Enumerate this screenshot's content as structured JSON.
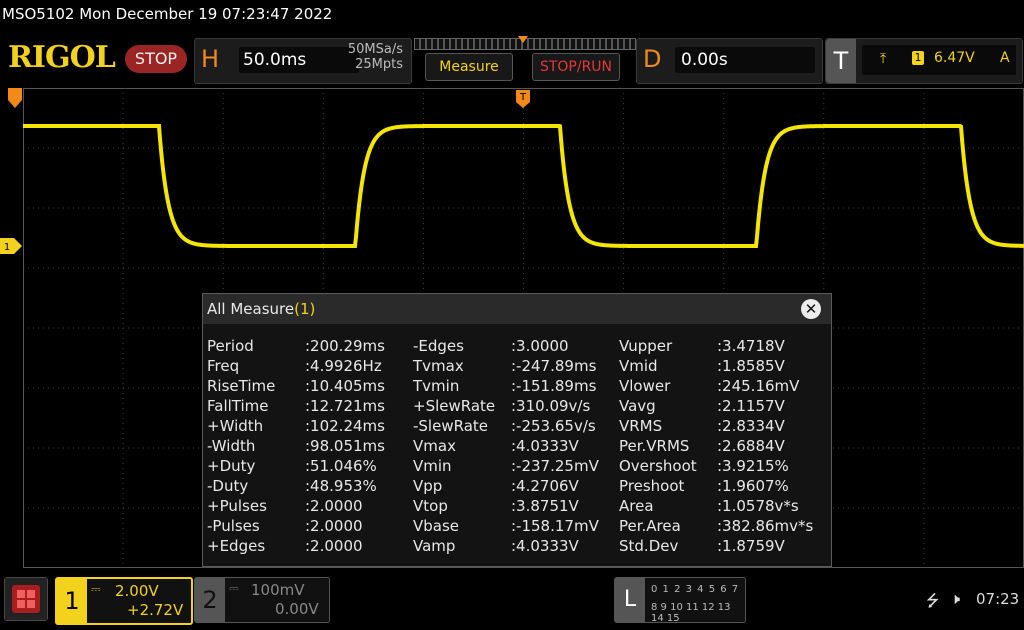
{
  "status_line": "MSO5102  Mon December 19 07:23:47 2022",
  "logo": "RIGOL",
  "run_state": "STOP",
  "horizontal": {
    "letter": "H",
    "timebase": "50.0ms",
    "sample_rate": "50MSa/s",
    "memory_depth": "25Mpts"
  },
  "buttons": {
    "measure": "Measure",
    "stop_run": "STOP/RUN"
  },
  "delay": {
    "letter": "D",
    "value": "0.00s"
  },
  "trigger": {
    "letter": "T",
    "edge_icon": "rising-edge-icon",
    "source": "1",
    "level": "6.47V",
    "mode": "A"
  },
  "markers": {
    "trigger_pos": "T",
    "ch1": "1"
  },
  "waveform": {
    "color": "#f5e600",
    "period_ms": 200.29,
    "duty_percent": 51.046,
    "vmax_v": 4.0333,
    "vmin_v": -0.23725
  },
  "measure_window": {
    "title": "All Measure",
    "title_channel": "(1)",
    "close": "✕",
    "columns": [
      [
        {
          "name": "Period",
          "value": ":200.29ms"
        },
        {
          "name": "Freq",
          "value": ":4.9926Hz"
        },
        {
          "name": "RiseTime",
          "value": ":10.405ms"
        },
        {
          "name": "FallTime",
          "value": ":12.721ms"
        },
        {
          "name": "+Width",
          "value": ":102.24ms"
        },
        {
          "name": "-Width",
          "value": ":98.051ms"
        },
        {
          "name": "+Duty",
          "value": ":51.046%"
        },
        {
          "name": "-Duty",
          "value": ":48.953%"
        },
        {
          "name": "+Pulses",
          "value": ":2.0000"
        },
        {
          "name": "-Pulses",
          "value": ":2.0000"
        },
        {
          "name": "+Edges",
          "value": ":2.0000"
        }
      ],
      [
        {
          "name": "-Edges",
          "value": ":3.0000"
        },
        {
          "name": "Tvmax",
          "value": ":-247.89ms"
        },
        {
          "name": "Tvmin",
          "value": ":-151.89ms"
        },
        {
          "name": "+SlewRate",
          "value": ":310.09v/s"
        },
        {
          "name": "-SlewRate",
          "value": ":-253.65v/s"
        },
        {
          "name": "Vmax",
          "value": ":4.0333V"
        },
        {
          "name": "Vmin",
          "value": ":-237.25mV"
        },
        {
          "name": "Vpp",
          "value": ":4.2706V"
        },
        {
          "name": "Vtop",
          "value": ":3.8751V"
        },
        {
          "name": "Vbase",
          "value": ":-158.17mV"
        },
        {
          "name": "Vamp",
          "value": ":4.0333V"
        }
      ],
      [
        {
          "name": "Vupper",
          "value": ":3.4718V"
        },
        {
          "name": "Vmid",
          "value": ":1.8585V"
        },
        {
          "name": "Vlower",
          "value": ":245.16mV"
        },
        {
          "name": "Vavg",
          "value": ":2.1157V"
        },
        {
          "name": "VRMS",
          "value": ":2.8334V"
        },
        {
          "name": "Per.VRMS",
          "value": ":2.6884V"
        },
        {
          "name": "Overshoot",
          "value": ":3.9215%"
        },
        {
          "name": "Preshoot",
          "value": ":1.9607%"
        },
        {
          "name": "Area",
          "value": ":1.0578v*s"
        },
        {
          "name": "Per.Area",
          "value": ":382.86mv*s"
        },
        {
          "name": "Std.Dev",
          "value": ":1.8759V"
        }
      ]
    ]
  },
  "channel1": {
    "number": "1",
    "scale": "2.00V",
    "offset": "+2.72V",
    "color": "#f2d21c"
  },
  "channel2": {
    "number": "2",
    "scale": "100mV",
    "offset": "0.00V"
  },
  "logic_analyzer": {
    "letter": "L",
    "row1": "0 1 2 3  4 5 6 7",
    "row2": "8 9 10 11 12 13 14 15"
  },
  "system": {
    "usb_icon": "usb-icon",
    "speaker_icon": "speaker-icon",
    "time": "07:23"
  }
}
